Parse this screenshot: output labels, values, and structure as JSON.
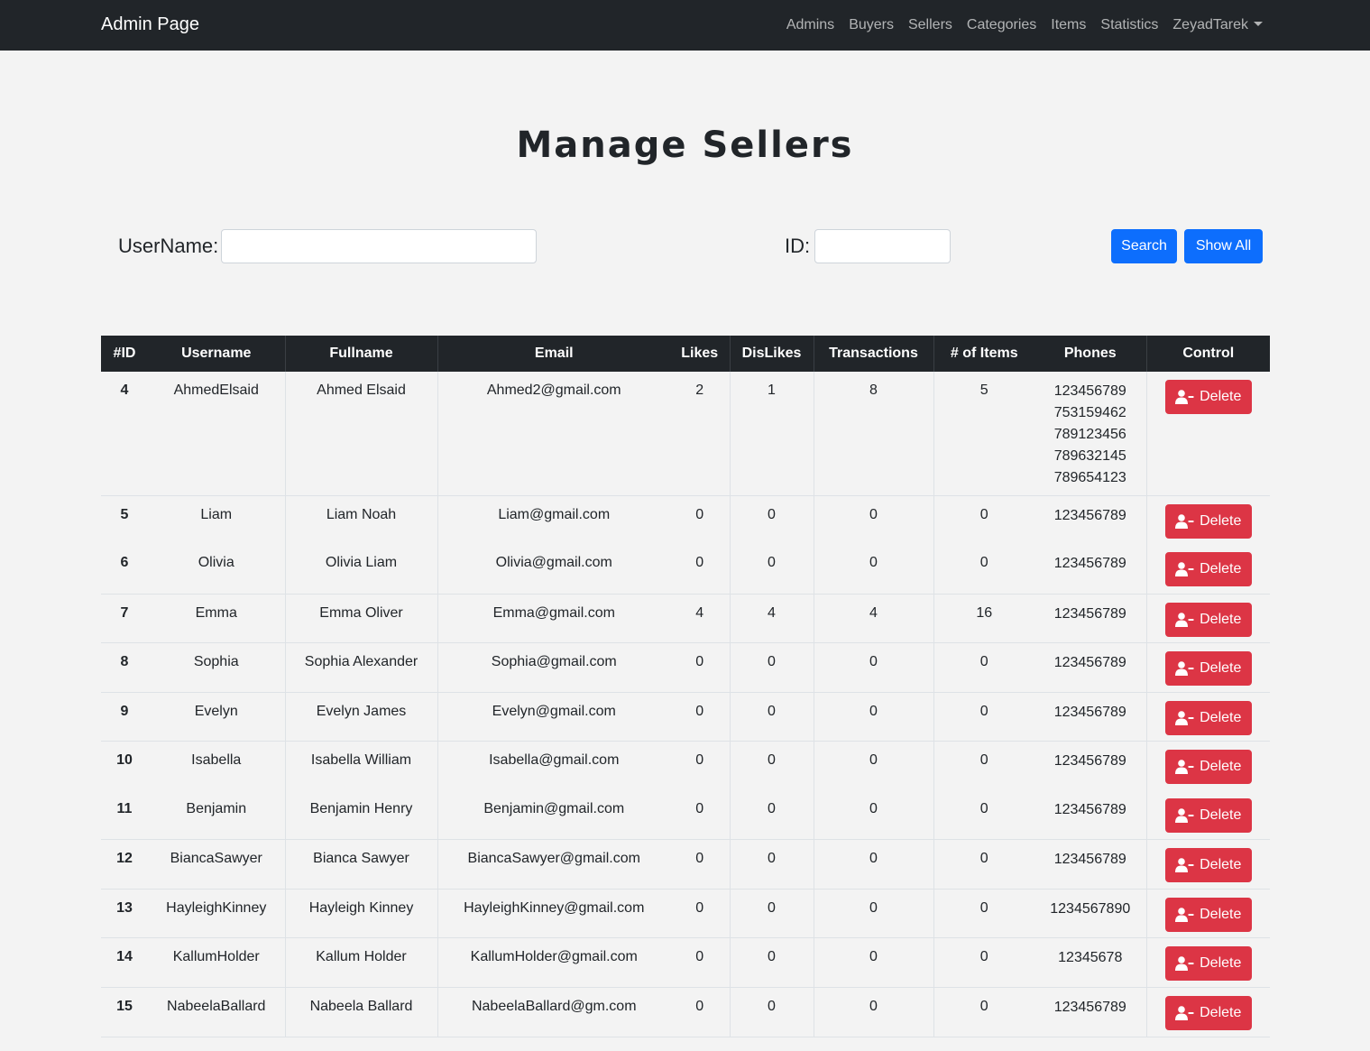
{
  "navbar": {
    "brand": "Admin Page",
    "links": [
      "Admins",
      "Buyers",
      "Sellers",
      "Categories",
      "Items",
      "Statistics"
    ],
    "user": "ZeyadTarek"
  },
  "page": {
    "title": "Manage Sellers"
  },
  "search": {
    "username_label": "UserName:",
    "username_value": "",
    "id_label": "ID:",
    "id_value": "",
    "search_button": "Search",
    "show_all_button": "Show All"
  },
  "table": {
    "headers": [
      "#ID",
      "Username",
      "Fullname",
      "Email",
      "Likes",
      "DisLikes",
      "Transactions",
      "# of Items",
      "Phones",
      "Control"
    ],
    "delete_label": "Delete",
    "rows": [
      {
        "id": "4",
        "username": "AhmedElsaid",
        "fullname": "Ahmed Elsaid",
        "email": "Ahmed2@gmail.com",
        "likes": "2",
        "dislikes": "1",
        "transactions": "8",
        "items": "5",
        "phones": [
          "123456789",
          "753159462",
          "789123456",
          "789632145",
          "789654123"
        ]
      },
      {
        "id": "5",
        "username": "Liam",
        "fullname": "Liam Noah",
        "email": "Liam@gmail.com",
        "likes": "0",
        "dislikes": "0",
        "transactions": "0",
        "items": "0",
        "phones": [
          "123456789"
        ]
      },
      {
        "id": "6",
        "username": "Olivia",
        "fullname": "Olivia Liam",
        "email": "Olivia@gmail.com",
        "likes": "0",
        "dislikes": "0",
        "transactions": "0",
        "items": "0",
        "phones": [
          "123456789"
        ]
      },
      {
        "id": "7",
        "username": "Emma",
        "fullname": "Emma Oliver",
        "email": "Emma@gmail.com",
        "likes": "4",
        "dislikes": "4",
        "transactions": "4",
        "items": "16",
        "phones": [
          "123456789"
        ]
      },
      {
        "id": "8",
        "username": "Sophia",
        "fullname": "Sophia Alexander",
        "email": "Sophia@gmail.com",
        "likes": "0",
        "dislikes": "0",
        "transactions": "0",
        "items": "0",
        "phones": [
          "123456789"
        ]
      },
      {
        "id": "9",
        "username": "Evelyn",
        "fullname": "Evelyn James",
        "email": "Evelyn@gmail.com",
        "likes": "0",
        "dislikes": "0",
        "transactions": "0",
        "items": "0",
        "phones": [
          "123456789"
        ]
      },
      {
        "id": "10",
        "username": "Isabella",
        "fullname": "Isabella William",
        "email": "Isabella@gmail.com",
        "likes": "0",
        "dislikes": "0",
        "transactions": "0",
        "items": "0",
        "phones": [
          "123456789"
        ]
      },
      {
        "id": "11",
        "username": "Benjamin",
        "fullname": "Benjamin Henry",
        "email": "Benjamin@gmail.com",
        "likes": "0",
        "dislikes": "0",
        "transactions": "0",
        "items": "0",
        "phones": [
          "123456789"
        ]
      },
      {
        "id": "12",
        "username": "BiancaSawyer",
        "fullname": "Bianca Sawyer",
        "email": "BiancaSawyer@gmail.com",
        "likes": "0",
        "dislikes": "0",
        "transactions": "0",
        "items": "0",
        "phones": [
          "123456789"
        ]
      },
      {
        "id": "13",
        "username": "HayleighKinney",
        "fullname": "Hayleigh Kinney",
        "email": "HayleighKinney@gmail.com",
        "likes": "0",
        "dislikes": "0",
        "transactions": "0",
        "items": "0",
        "phones": [
          "1234567890"
        ]
      },
      {
        "id": "14",
        "username": "KallumHolder",
        "fullname": "Kallum Holder",
        "email": "KallumHolder@gmail.com",
        "likes": "0",
        "dislikes": "0",
        "transactions": "0",
        "items": "0",
        "phones": [
          "12345678"
        ]
      },
      {
        "id": "15",
        "username": "NabeelaBallard",
        "fullname": "Nabeela Ballard",
        "email": "NabeelaBallard@gm.com",
        "likes": "0",
        "dislikes": "0",
        "transactions": "0",
        "items": "0",
        "phones": [
          "123456789"
        ]
      }
    ]
  },
  "colors": {
    "navbar": "#212529",
    "primary": "#0d6efd",
    "danger": "#dc3545",
    "background": "#f3f3f3"
  },
  "icons": {
    "delete_button_icon": "user-minus-icon",
    "user_menu_icon": "caret-down-icon"
  }
}
